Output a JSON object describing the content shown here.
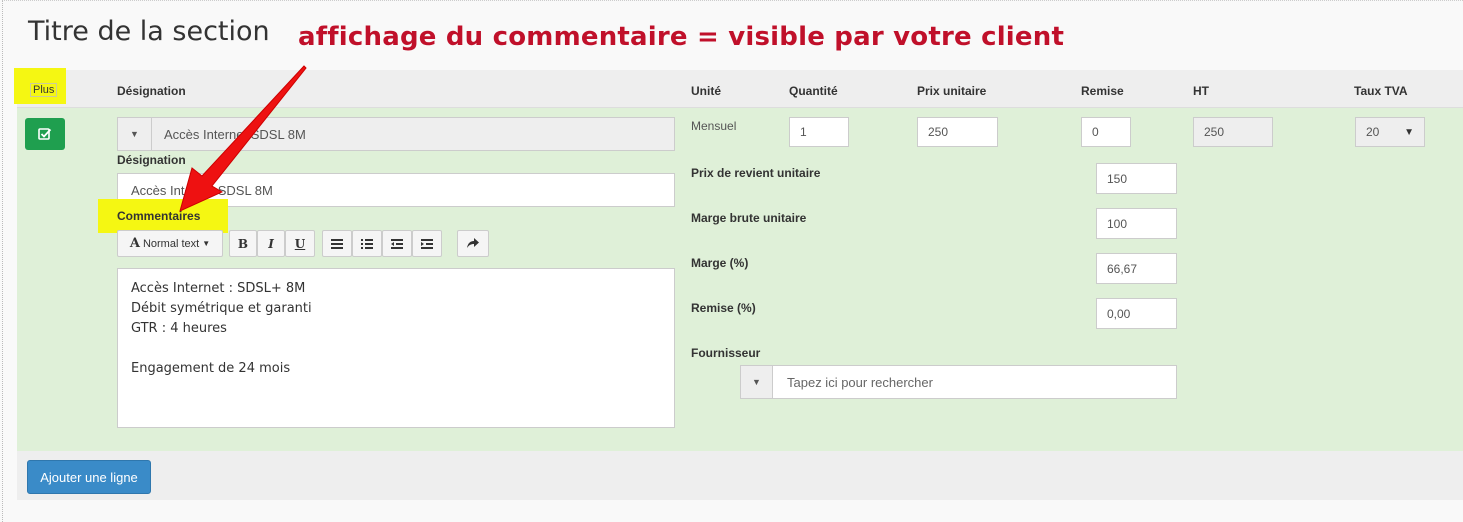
{
  "section": {
    "title": "Titre de la section"
  },
  "annotation": {
    "text": "affichage du commentaire = visible par votre client",
    "color": "#c0102a"
  },
  "table_header": {
    "plus": "Plus",
    "designation": "Désignation",
    "unite": "Unité",
    "quantite": "Quantité",
    "prix_unitaire": "Prix unitaire",
    "remise": "Remise",
    "ht": "HT",
    "taux_tva": "Taux TVA"
  },
  "line": {
    "product_select": "Accès Internet SDSL 8M",
    "designation_label": "Désignation",
    "designation_value": "Accès Internet SDSL 8M",
    "commentaires_label": "Commentaires",
    "unit": "Mensuel",
    "quantite": "1",
    "prix_unitaire": "250",
    "remise": "0",
    "ht": "250",
    "taux_tva": "20"
  },
  "toolbar": {
    "normal_text": "Normal text",
    "bold": "B",
    "italic": "I",
    "underline": "U"
  },
  "editor": {
    "lines": [
      "Accès Internet : SDSL+ 8M",
      "Débit symétrique et garanti",
      "GTR : 4 heures",
      "",
      "Engagement de 24 mois"
    ]
  },
  "costing": {
    "prix_revient_label": "Prix de revient unitaire",
    "prix_revient_value": "150",
    "marge_brute_label": "Marge brute unitaire",
    "marge_brute_value": "100",
    "marge_pct_label": "Marge (%)",
    "marge_pct_value": "66,67",
    "remise_pct_label": "Remise (%)",
    "remise_pct_value": "0,00",
    "fournisseur_label": "Fournisseur",
    "fournisseur_placeholder": "Tapez ici pour rechercher"
  },
  "footer": {
    "add_line": "Ajouter une ligne"
  },
  "colors": {
    "highlight": "#f5f712",
    "row_bg": "#dff0d8",
    "check_button": "#1f9f4f",
    "primary_button": "#3a8bc8",
    "arrow": "#ee1111"
  }
}
